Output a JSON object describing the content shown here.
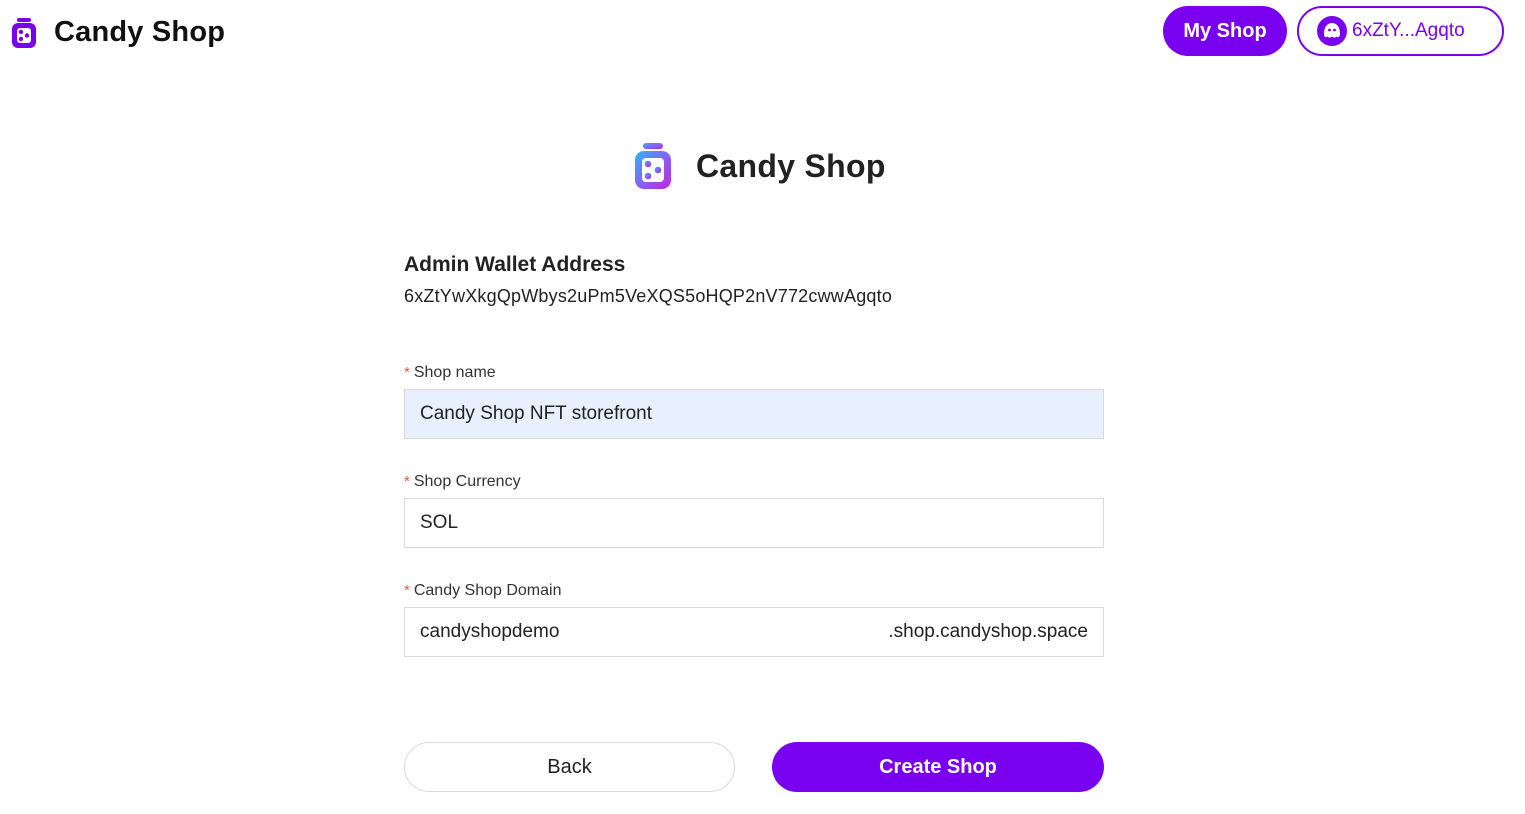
{
  "header": {
    "brand_title": "Candy Shop",
    "my_shop_label": "My Shop",
    "wallet_short": "6xZtY...Agqto"
  },
  "hero": {
    "title": "Candy Shop"
  },
  "form": {
    "admin_wallet_title": "Admin Wallet Address",
    "admin_wallet_address": "6xZtYwXkgQpWbys2uPm5VeXQS5oHQP2nV772cwwAgqto",
    "required_mark": "*",
    "shop_name": {
      "label": "Shop name",
      "value": "Candy Shop NFT storefront"
    },
    "shop_currency": {
      "label": "Shop Currency",
      "value": "SOL"
    },
    "shop_domain": {
      "label": "Candy Shop Domain",
      "value": "candyshopdemo",
      "suffix": ".shop.candyshop.space"
    }
  },
  "actions": {
    "back_label": "Back",
    "create_label": "Create Shop"
  },
  "colors": {
    "accent": "#7a00f0",
    "required": "#ff4d4f",
    "autofill_bg": "#e8f0fe"
  },
  "icons": {
    "brand": "candy-jar-icon",
    "wallet_avatar": "ghost-avatar-icon"
  }
}
